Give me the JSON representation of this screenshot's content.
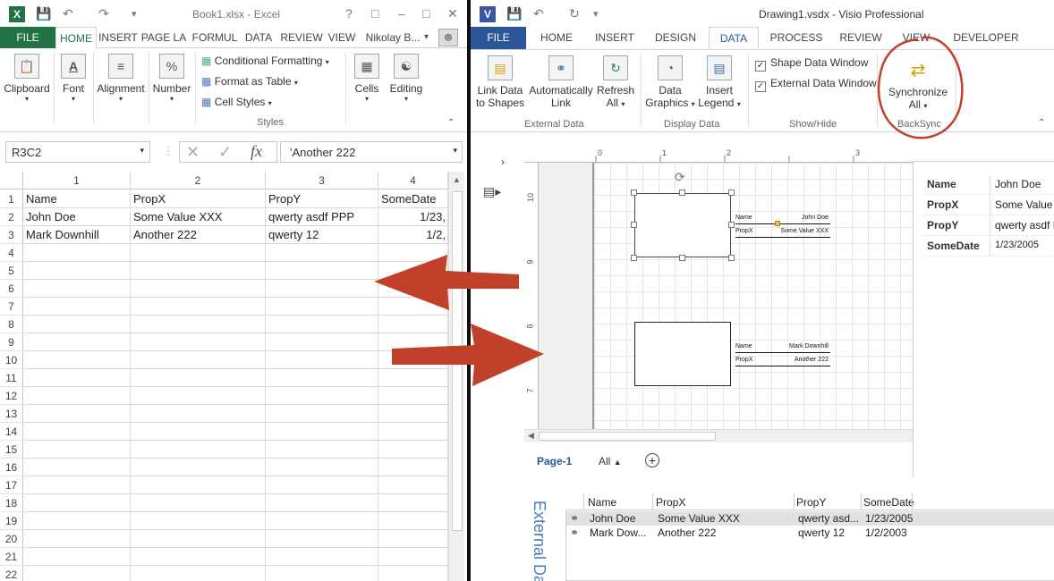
{
  "excel": {
    "title": "Book1.xlsx - Excel",
    "help": "?",
    "tabs": [
      "FILE",
      "HOME",
      "INSERT",
      "PAGE LA",
      "FORMUL",
      "DATA",
      "REVIEW",
      "VIEW"
    ],
    "user": "Nikolay B...",
    "ribbon": {
      "clipboard": "Clipboard",
      "font": "Font",
      "alignment": "Alignment",
      "number": "Number",
      "conditional": "Conditional Formatting",
      "format_table": "Format as Table",
      "cell_styles": "Cell Styles",
      "styles": "Styles",
      "cells": "Cells",
      "editing": "Editing"
    },
    "namebox": "R3C2",
    "formula": "'Another 222",
    "fx": "fx",
    "col_headers": [
      "1",
      "2",
      "3",
      "4"
    ],
    "rows": [
      [
        "Name",
        "PropX",
        "PropY",
        "SomeDate"
      ],
      [
        "John Doe",
        "Some Value XXX",
        "qwerty asdf PPP",
        "1/23,"
      ],
      [
        "Mark Downhill",
        "Another 222",
        "qwerty 12",
        "1/2,"
      ]
    ],
    "row_numbers": [
      "1",
      "2",
      "3",
      "4",
      "5",
      "6",
      "7",
      "8",
      "9",
      "10",
      "11",
      "12",
      "13",
      "14",
      "15",
      "16",
      "17",
      "18",
      "19",
      "20",
      "21",
      "22"
    ]
  },
  "visio": {
    "title": "Drawing1.vsdx - Visio Professional",
    "tabs": [
      "FILE",
      "HOME",
      "INSERT",
      "DESIGN",
      "DATA",
      "PROCESS",
      "REVIEW",
      "VIEW",
      "DEVELOPER"
    ],
    "ribbon": {
      "link_data": [
        "Link Data",
        "to Shapes"
      ],
      "auto_link": [
        "Automatically",
        "Link"
      ],
      "refresh": [
        "Refresh",
        "All"
      ],
      "external_data": "External Data",
      "data_graphics": [
        "Data",
        "Graphics"
      ],
      "insert_legend": [
        "Insert",
        "Legend"
      ],
      "display_data": "Display Data",
      "shape_data_window": "Shape Data Window",
      "external_data_window": "External Data Window",
      "show_hide": "Show/Hide",
      "sync": [
        "Synchronize",
        "All"
      ],
      "backsync": "BackSync"
    },
    "ruler_top": [
      "0",
      "1",
      "2",
      "3"
    ],
    "ruler_left": [
      "10",
      "9",
      "8",
      "7"
    ],
    "shape1": {
      "name_label": "Name",
      "name_val": "John Doe",
      "propx_label": "PropX",
      "propx_val": "Some Value XXX"
    },
    "shape2": {
      "name_label": "Name",
      "name_val": "Mark Downhill",
      "propx_label": "PropX",
      "propx_val": "Another 222"
    },
    "shape_data": [
      {
        "label": "Name",
        "value": "John Doe"
      },
      {
        "label": "PropX",
        "value": "Some Value X"
      },
      {
        "label": "PropY",
        "value": "qwerty asdf P"
      },
      {
        "label": "SomeDate",
        "value": "1/23/2005"
      }
    ],
    "page_tab": "Page-1",
    "all_tab": "All",
    "external_label": "External Da",
    "ext_headers": [
      "Name",
      "PropX",
      "PropY",
      "SomeDate"
    ],
    "ext_rows": [
      [
        "John Doe",
        "Some Value XXX",
        "qwerty asd...",
        "1/23/2005"
      ],
      [
        "Mark Dow...",
        "Another 222",
        "qwerty 12",
        "1/2/2003"
      ]
    ]
  },
  "colors": {
    "excel_green": "#217346",
    "visio_blue": "#2b579a",
    "arrow_red": "#c0402a"
  }
}
